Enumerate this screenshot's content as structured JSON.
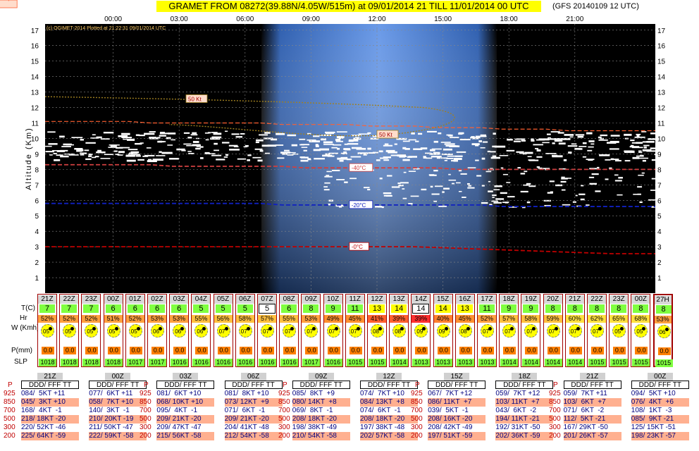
{
  "header": {
    "title": "GRAMET FROM 08272(39.88N/4.05W/515m) at 09/01/2014 21   TILL  11/01/2014 00 UTC",
    "model_run": "(GFS 20140109 12 UTC)",
    "credit": "(c) OGIMET-2014 Plotted at 21:22:31 09/01/2014 UTC"
  },
  "chart_data": {
    "type": "line",
    "title": "GRAMET FROM 08272(39.88N/4.05W/515m) at 09/01/2014 21   TILL  11/01/2014 00 UTC",
    "ylabel": "Altitude (Km)",
    "ylim": [
      0,
      17.4
    ],
    "yticks": [
      "1",
      "2",
      "3",
      "4",
      "5",
      "6",
      "7",
      "8",
      "9",
      "10",
      "11",
      "12",
      "13",
      "14",
      "15",
      "16",
      "17"
    ],
    "xticks": [
      "00:00",
      "03:00",
      "06:00",
      "09:00",
      "12:00",
      "15:00",
      "18:00",
      "21:00"
    ],
    "grid": true,
    "daylight_hours": [
      7,
      17
    ],
    "series": [
      {
        "name": "Trop",
        "label": "Trop",
        "values": [
          11.1,
          11.1,
          11.1,
          11.1,
          11.1,
          11.0,
          11.0,
          11.0,
          11.0,
          11.0,
          11.0,
          10.9,
          10.9,
          10.9,
          10.9,
          10.8,
          10.8,
          10.8,
          10.7,
          10.7,
          10.7,
          10.6,
          10.6,
          10.6,
          10.5,
          10.5,
          10.5
        ]
      },
      {
        "name": "-40°C",
        "label": "-40°C",
        "values": [
          8.3,
          8.3,
          8.3,
          8.3,
          8.3,
          8.3,
          8.2,
          8.2,
          8.2,
          8.2,
          8.2,
          8.2,
          8.1,
          8.1,
          8.1,
          8.1,
          8.1,
          8.1,
          8.1,
          8.0,
          8.0,
          8.0,
          8.0,
          8.0,
          8.0,
          8.0,
          8.0
        ]
      },
      {
        "name": "-20°C",
        "label": "-20°C",
        "values": [
          5.8,
          5.8,
          5.8,
          5.8,
          5.8,
          5.8,
          5.8,
          5.8,
          5.8,
          5.8,
          5.8,
          5.7,
          5.7,
          5.7,
          5.7,
          5.7,
          5.7,
          5.7,
          5.7,
          5.7,
          5.7,
          5.6,
          5.6,
          5.6,
          5.6,
          5.6,
          5.6
        ]
      },
      {
        "name": "0°C",
        "label": "-0°C",
        "values": [
          3.0,
          3.0,
          3.0,
          3.0,
          3.0,
          3.0,
          3.0,
          3.0,
          3.0,
          3.0,
          3.0,
          3.0,
          3.0,
          3.0,
          3.0,
          3.0,
          3.0,
          3.0,
          2.95,
          2.9,
          2.85,
          2.8,
          2.75,
          2.7,
          2.65,
          2.6,
          2.55
        ]
      }
    ],
    "isotach_label": "50 Kt"
  },
  "hours": [
    {
      "label": "21Z",
      "t": "7",
      "hr": "52%",
      "hr_color": "#ffa040",
      "w": "05",
      "p": "0.0",
      "slp": "1018"
    },
    {
      "label": "22Z",
      "t": "7",
      "hr": "52%",
      "hr_color": "#ffa040",
      "w": "05",
      "p": "0.0",
      "slp": "1018"
    },
    {
      "label": "23Z",
      "t": "7",
      "hr": "52%",
      "hr_color": "#ffa040",
      "w": "05",
      "p": "0.0",
      "slp": "1018"
    },
    {
      "label": "00Z",
      "t": "6",
      "hr": "51%",
      "hr_color": "#ffa040",
      "w": "05",
      "p": "0.0",
      "slp": "1018"
    },
    {
      "label": "01Z",
      "t": "6",
      "hr": "52%",
      "hr_color": "#ffa040",
      "w": "05",
      "p": "0.0",
      "slp": "1017"
    },
    {
      "label": "02Z",
      "t": "6",
      "hr": "53%",
      "hr_color": "#ffa040",
      "w": "06",
      "p": "0.0",
      "slp": "1017"
    },
    {
      "label": "03Z",
      "t": "6",
      "hr": "53%",
      "hr_color": "#ffa040",
      "w": "06",
      "p": "0.0",
      "slp": "1016"
    },
    {
      "label": "04Z",
      "t": "5",
      "hr": "55%",
      "hr_color": "#ffc040",
      "w": "06",
      "p": "0.0",
      "slp": "1016"
    },
    {
      "label": "05Z",
      "t": "5",
      "hr": "56%",
      "hr_color": "#ffc040",
      "w": "07",
      "p": "0.0",
      "slp": "1016"
    },
    {
      "label": "06Z",
      "t": "5",
      "hr": "58%",
      "hr_color": "#ffc040",
      "w": "07",
      "p": "0.0",
      "slp": "1016"
    },
    {
      "label": "07Z",
      "t": "5",
      "hr": "57%",
      "hr_color": "#ffc040",
      "w": "07",
      "p": "0.0",
      "slp": "1016",
      "boxed": true
    },
    {
      "label": "08Z",
      "t": "6",
      "hr": "55%",
      "hr_color": "#ffc040",
      "w": "07",
      "p": "0.0",
      "slp": "1016"
    },
    {
      "label": "09Z",
      "t": "8",
      "hr": "53%",
      "hr_color": "#ffa040",
      "w": "07",
      "p": "0.0",
      "slp": "1017"
    },
    {
      "label": "10Z",
      "t": "9",
      "hr": "49%",
      "hr_color": "#ff9030",
      "w": "07",
      "p": "0.0",
      "slp": "1016"
    },
    {
      "label": "11Z",
      "t": "11",
      "hr": "45%",
      "hr_color": "#ff9030",
      "w": "07",
      "p": "0.0",
      "slp": "1015"
    },
    {
      "label": "12Z",
      "t": "13",
      "hr": "41%",
      "hr_color": "#ff6030",
      "w": "08",
      "p": "0.0",
      "slp": "1015"
    },
    {
      "label": "13Z",
      "t": "14",
      "hr": "39%",
      "hr_color": "#ff6030",
      "w": "08",
      "p": "0.0",
      "slp": "1014"
    },
    {
      "label": "14Z",
      "t": "14",
      "hr": "39%",
      "hr_color": "#ff3030",
      "w": "09",
      "p": "0.0",
      "slp": "1013",
      "boxed": true
    },
    {
      "label": "15Z",
      "t": "14",
      "hr": "40%",
      "hr_color": "#ff8030",
      "w": "09",
      "p": "0.0",
      "slp": "1013"
    },
    {
      "label": "16Z",
      "t": "13",
      "hr": "45%",
      "hr_color": "#ff9030",
      "w": "08",
      "p": "0.0",
      "slp": "1013"
    },
    {
      "label": "17Z",
      "t": "11",
      "hr": "52%",
      "hr_color": "#ffa040",
      "w": "07",
      "p": "0.0",
      "slp": "1013"
    },
    {
      "label": "18Z",
      "t": "9",
      "hr": "57%",
      "hr_color": "#ffc040",
      "w": "07",
      "p": "0.0",
      "slp": "1014"
    },
    {
      "label": "19Z",
      "t": "9",
      "hr": "58%",
      "hr_color": "#ffc040",
      "w": "07",
      "p": "0.0",
      "slp": "1014"
    },
    {
      "label": "20Z",
      "t": "8",
      "hr": "59%",
      "hr_color": "#ffc040",
      "w": "07",
      "p": "0.0",
      "slp": "1014"
    },
    {
      "label": "21Z",
      "t": "8",
      "hr": "60%",
      "hr_color": "#ffe040",
      "w": "07",
      "p": "0.0",
      "slp": "1014"
    },
    {
      "label": "22Z",
      "t": "8",
      "hr": "62%",
      "hr_color": "#ffe040",
      "w": "07",
      "p": "0.0",
      "slp": "1015"
    },
    {
      "label": "23Z",
      "t": "8",
      "hr": "65%",
      "hr_color": "#ffe040",
      "w": "05",
      "p": "0.0",
      "slp": "1015"
    },
    {
      "label": "00Z",
      "t": "8",
      "hr": "68%",
      "hr_color": "#ffe040",
      "w": "05",
      "p": "0.0",
      "slp": "1015"
    },
    {
      "label": "27H",
      "t": "8",
      "hr": "53%",
      "hr_color": "#ffa040",
      "w": "06",
      "p": "0.0",
      "slp": "1015"
    }
  ],
  "row_labels": {
    "t": "T(C)",
    "hr": "Hr",
    "w": "W (Kmh)",
    "p": "P(mm)",
    "slp": "SLP"
  },
  "pressure_levels": [
    "925",
    "850",
    "700",
    "500",
    "300",
    "200"
  ],
  "level_header_p": "P",
  "soundings": [
    {
      "time": "21Z",
      "header": "DDD/ FFF TT",
      "rows": [
        "084/  5KT +11",
        "045/  3KT +10",
        "168/  4KT  -1",
        "218/ 18KT -20",
        "220/ 52KT -46",
        "225/ 64KT -59"
      ]
    },
    {
      "time": "00Z",
      "header": "DDD/ FFF TT",
      "rows": [
        "077/  6KT +11",
        "058/  7KT +10",
        "140/  3KT  -1",
        "210/ 20KT -19",
        "211/ 50KT -47",
        "222/ 59KT -58"
      ]
    },
    {
      "time": "03Z",
      "header": "DDD/ FFF TT",
      "rows": [
        "081/  6KT +10",
        "068/ 10KT +10",
        "095/  4KT  -1",
        "209/ 21KT -20",
        "209/ 47KT -47",
        "215/ 56KT -58"
      ]
    },
    {
      "time": "06Z",
      "header": "DDD/ FFF TT",
      "rows": [
        "081/  8KT +10",
        "073/ 12KT  +9",
        "071/  6KT  -1",
        "209/ 21KT -20",
        "204/ 41KT -48",
        "212/ 54KT -58"
      ]
    },
    {
      "time": "09Z",
      "header": "DDD/ FFF TT",
      "rows": [
        "085/  8KT  +9",
        "080/ 14KT  +8",
        "069/  8KT  -1",
        "208/ 18KT -20",
        "198/ 38KT -49",
        "210/ 54KT -58"
      ]
    },
    {
      "time": "12Z",
      "header": "DDD/ FFF TT",
      "rows": [
        "074/  7KT +10",
        "084/ 13KT  +8",
        "074/  6KT  -1",
        "208/ 18KT -20",
        "197/ 38KT -48",
        "202/ 57KT -58"
      ]
    },
    {
      "time": "15Z",
      "header": "DDD/ FFF TT",
      "rows": [
        "067/  7KT +12",
        "086/ 11KT  +7",
        "039/  5KT  -1",
        "208/ 16KT -20",
        "208/ 42KT -49",
        "197/ 51KT -59"
      ]
    },
    {
      "time": "18Z",
      "header": "DDD/ FFF TT",
      "rows": [
        "059/  7KT +12",
        "103/ 11KT  +7",
        "043/  6KT  -2",
        "194/ 11KT -21",
        "192/ 31KT -50",
        "202/ 36KT -59"
      ]
    },
    {
      "time": "21Z",
      "header": "DDD/ FFF TT",
      "rows": [
        "059/  7KT +11",
        "103/  6KT  +7",
        "071/  6KT  -2",
        "112/  5KT -21",
        "167/ 29KT -50",
        "201/ 26KT -57"
      ]
    },
    {
      "time": "00Z",
      "header": "DDD/ FFF TT",
      "rows": [
        "094/  5KT +10",
        "076/  4KT  +6",
        "108/  1KT  -3",
        "085/  9KT -21",
        "125/ 15KT -51",
        "198/ 23KT -57"
      ]
    }
  ],
  "colors": {
    "trop": "#ff6030",
    "minus40": "#d04040",
    "minus20": "#1020c0",
    "zero": "#c00000",
    "isotach": "#a08020",
    "daylight": "#5a8ee0",
    "night": "#000000"
  }
}
